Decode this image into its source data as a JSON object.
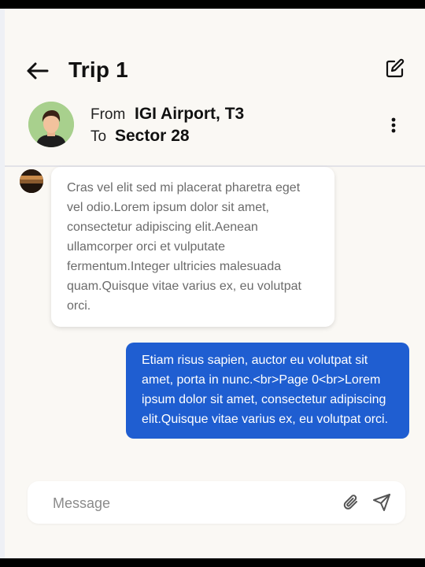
{
  "header": {
    "title": "Trip 1",
    "from_label": "From",
    "from_value": "IGI Airport, T3",
    "to_label": "To",
    "to_value": "Sector 28"
  },
  "icons": {
    "back": "arrow-left-icon",
    "edit": "edit-icon",
    "more": "more-vertical-icon",
    "attach": "paperclip-icon",
    "send": "send-icon"
  },
  "messages": [
    {
      "direction": "incoming",
      "text": "Cras vel elit sed mi placerat pharetra eget vel odio.Lorem ipsum dolor sit amet, consectetur adipiscing elit.Aenean ullamcorper orci et vulputate fermentum.Integer ultricies malesuada quam.Quisque vitae varius ex, eu volutpat orci."
    },
    {
      "direction": "outgoing",
      "text": "Etiam risus sapien, auctor eu volutpat sit amet, porta in nunc.<br>Page 0<br>Lorem ipsum dolor sit amet, consectetur adipiscing elit.Quisque vitae varius ex, eu volutpat orci."
    }
  ],
  "composer": {
    "placeholder": "Message"
  },
  "colors": {
    "outgoing_bubble": "#1f5ed1",
    "avatar_bg": "#a8d08d",
    "background": "#faf8f4"
  }
}
